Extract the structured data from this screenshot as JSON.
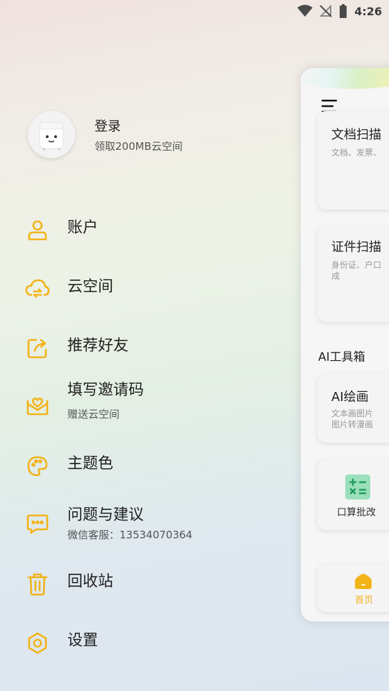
{
  "status_bar": {
    "time": "4:26"
  },
  "profile": {
    "login": "登录",
    "subtitle": "领取200MB云空间"
  },
  "menu": [
    {
      "label": "账户",
      "icon": "user-icon"
    },
    {
      "label": "云空间",
      "icon": "cloud-sync-icon"
    },
    {
      "label": "推荐好友",
      "icon": "share-icon"
    },
    {
      "label": "填写邀请码",
      "sub": "赠送云空间",
      "icon": "envelope-icon"
    },
    {
      "label": "主题色",
      "icon": "palette-icon"
    },
    {
      "label": "问题与建议",
      "sub": "微信客服：13534070364",
      "icon": "chat-icon"
    },
    {
      "label": "回收站",
      "icon": "trash-icon"
    },
    {
      "label": "设置",
      "icon": "settings-icon"
    }
  ],
  "preview": {
    "cards": [
      {
        "title": "文档扫描",
        "desc": "文档、发票、"
      },
      {
        "title": "证件扫描",
        "desc": "身份证、户口",
        "desc2": "成"
      }
    ],
    "ai_section": "AI工具箱",
    "ai_card": {
      "title": "AI绘画",
      "desc": "文本画图片",
      "desc2": "图片转漫画"
    },
    "calc": "口算批改",
    "nav_home": "首页"
  },
  "colors": {
    "accent": "#f2b318",
    "calc_icon": "#9be0bb"
  }
}
